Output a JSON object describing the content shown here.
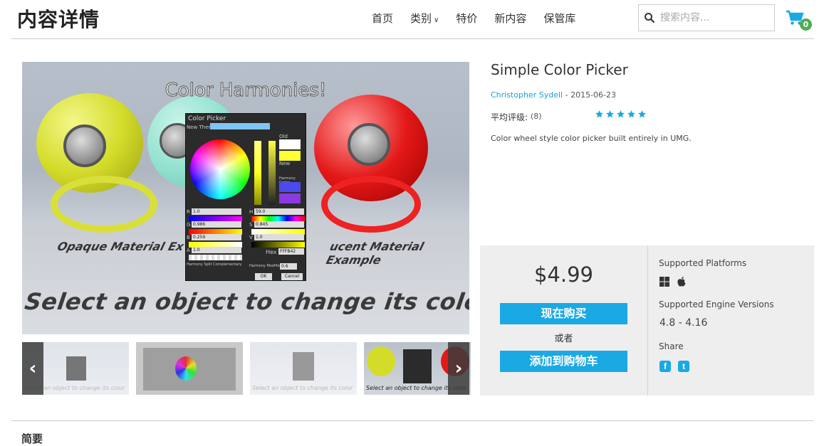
{
  "header": {
    "page_title": "内容详情",
    "nav": [
      {
        "label": "首页"
      },
      {
        "label": "类别",
        "has_dropdown": true
      },
      {
        "label": "特价"
      },
      {
        "label": "新内容"
      },
      {
        "label": "保管库"
      }
    ],
    "search": {
      "placeholder": "搜索内容..."
    },
    "cart_count": "0"
  },
  "gallery": {
    "hero": {
      "caption": "Color Harmonies!",
      "label_left": "Opaque Material Ex",
      "label_right": "ucent Material Example",
      "bottom_text": "Select an object to change its color .",
      "picker": {
        "title": "Color Picker",
        "theme_label": "New Theme",
        "old_label": "Old",
        "new_label": "New",
        "harmony_label": "Harmony Colors",
        "r_label": "R",
        "r_value": "1.0",
        "g_label": "G",
        "g_value": "0.986",
        "b_label": "B",
        "b_value": "0.259",
        "a_label": "A",
        "a_value": "1.0",
        "h_label": "H",
        "h_value": "59.0",
        "s_label": "S",
        "s_value": "0.845",
        "v_label": "V",
        "v_value": "1.0",
        "hex_label": "Hex",
        "hex_value": "FFFB42",
        "harmony_split": "Harmony Split Complementary",
        "harmony_modifier": "Harmony Modifier",
        "modifier_value": "0.6",
        "ok_label": "OK",
        "cancel_label": "Cancel"
      }
    },
    "thumbnails": [
      {
        "alt": "thumbnail-1"
      },
      {
        "alt": "thumbnail-2"
      },
      {
        "alt": "thumbnail-3"
      },
      {
        "alt": "thumbnail-4",
        "selected": true
      }
    ],
    "thumb_text": "Select an object to change its color",
    "prev_icon": "chevron-left",
    "next_icon": "chevron-right"
  },
  "product": {
    "title": "Simple Color Picker",
    "author": "Christopher Sydell",
    "date_sep": " - ",
    "date": "2015-06-23",
    "rating_label": "平均评级:",
    "rating_count": "(8)",
    "rating_stars": 5,
    "description": "Color wheel style color picker built entirely in UMG."
  },
  "purchase": {
    "price": "$4.99",
    "buy_label": "现在购买",
    "or_label": "或者",
    "add_cart_label": "添加到购物车",
    "platforms_heading": "Supported Platforms",
    "platforms": [
      "windows-icon",
      "apple-icon"
    ],
    "engine_heading": "Supported Engine Versions",
    "engine_versions": "4.8 - 4.16",
    "share_heading": "Share",
    "share": [
      {
        "icon": "facebook-icon",
        "glyph": "f"
      },
      {
        "icon": "twitter-icon",
        "glyph": "t"
      }
    ]
  },
  "footer_section": {
    "title": "简要"
  },
  "colors": {
    "accent": "#1aa9e3",
    "badge": "#4caf50",
    "buybox_bg": "#eeeeee"
  }
}
